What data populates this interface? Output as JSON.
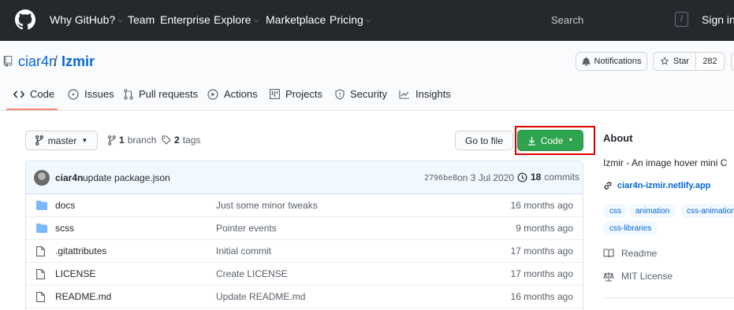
{
  "header": {
    "nav": [
      {
        "label": "Why GitHub?",
        "dropdown": true
      },
      {
        "label": "Team",
        "dropdown": false
      },
      {
        "label": "Enterprise",
        "dropdown": false
      },
      {
        "label": "Explore",
        "dropdown": true
      },
      {
        "label": "Marketplace",
        "dropdown": false
      },
      {
        "label": "Pricing",
        "dropdown": true
      }
    ],
    "search_placeholder": "Search",
    "search_shortcut": "/",
    "signin_label": "Sign in"
  },
  "repo": {
    "owner": "ciar4n",
    "separator": "/",
    "name": "Izmir",
    "notifications_label": "Notifications",
    "star_label": "Star",
    "star_count": "282"
  },
  "tabs": [
    {
      "label": "Code",
      "icon": "code-icon",
      "selected": true
    },
    {
      "label": "Issues",
      "icon": "issue-icon",
      "selected": false
    },
    {
      "label": "Pull requests",
      "icon": "pull-request-icon",
      "selected": false
    },
    {
      "label": "Actions",
      "icon": "play-icon",
      "selected": false
    },
    {
      "label": "Projects",
      "icon": "project-icon",
      "selected": false
    },
    {
      "label": "Security",
      "icon": "shield-icon",
      "selected": false
    },
    {
      "label": "Insights",
      "icon": "graph-icon",
      "selected": false
    }
  ],
  "branch_bar": {
    "branch_label": "master",
    "branches_count": "1",
    "branches_label": "branch",
    "tags_count": "2",
    "tags_label": "tags",
    "go_to_file_label": "Go to file",
    "code_button_label": "Code"
  },
  "latest_commit": {
    "author": "ciar4n",
    "message": "update package.json",
    "sha": "2796be8",
    "date": "on 3 Jul 2020",
    "commits_count": "18",
    "commits_label": "commits"
  },
  "files": [
    {
      "type": "directory",
      "name": "docs",
      "message": "Just some minor tweaks",
      "age": "16 months ago"
    },
    {
      "type": "directory",
      "name": "scss",
      "message": "Pointer events",
      "age": "9 months ago"
    },
    {
      "type": "file",
      "name": ".gitattributes",
      "message": "Initial commit",
      "age": "17 months ago"
    },
    {
      "type": "file",
      "name": "LICENSE",
      "message": "Create LICENSE",
      "age": "17 months ago"
    },
    {
      "type": "file",
      "name": "README.md",
      "message": "Update README.md",
      "age": "16 months ago"
    }
  ],
  "about": {
    "title": "About",
    "description": "Izmir - An image hover mini C",
    "website": "ciar4n-izmir.netlify.app",
    "topics": [
      "css",
      "animation",
      "css-animation",
      "css-libraries"
    ],
    "readme_label": "Readme",
    "license_label": "MIT License"
  },
  "colors": {
    "header_bg": "#24292e",
    "link_blue": "#0366d6",
    "code_button_green": "#2ea44f",
    "selected_tab_underline": "#f9826c",
    "highlight_box": "#e00000",
    "folder_blue": "#79b8ff"
  }
}
